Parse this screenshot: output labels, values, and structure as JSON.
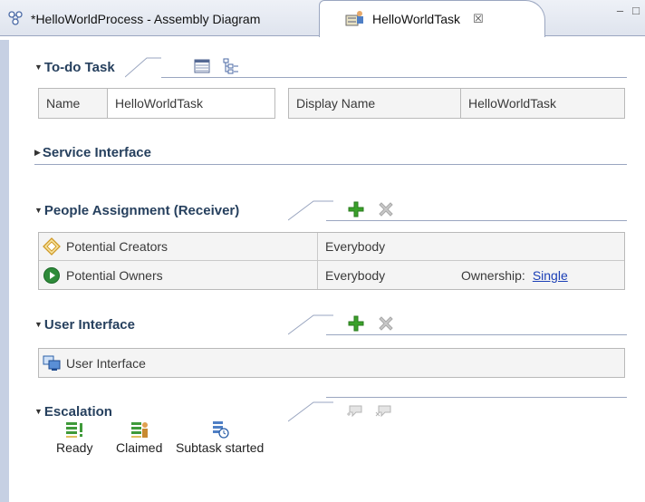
{
  "tabs": [
    {
      "label": "*HelloWorldProcess - Assembly Diagram",
      "icon": "assembly-diagram-icon",
      "active": false
    },
    {
      "label": "HelloWorldTask",
      "icon": "human-task-icon",
      "active": true,
      "close_glyph": "☒"
    }
  ],
  "window_controls": {
    "minimize": "–",
    "maximize": "□"
  },
  "todo_task": {
    "title": "To-do Task",
    "name_label": "Name",
    "name_value": "HelloWorldTask",
    "display_name_label": "Display Name",
    "display_name_value": "HelloWorldTask"
  },
  "service_interface": {
    "title": "Service Interface"
  },
  "people_assignment": {
    "title": "People Assignment (Receiver)",
    "rows": [
      {
        "role": "Potential Creators",
        "value": "Everybody",
        "ownership_label": "",
        "ownership_value": ""
      },
      {
        "role": "Potential Owners",
        "value": "Everybody",
        "ownership_label": "Ownership:",
        "ownership_value": "Single"
      }
    ]
  },
  "user_interface": {
    "title": "User Interface",
    "rows": [
      {
        "label": "User Interface"
      }
    ]
  },
  "escalation": {
    "title": "Escalation",
    "states": [
      {
        "label": "Ready",
        "icon": "ready-state-icon"
      },
      {
        "label": "Claimed",
        "icon": "claimed-state-icon"
      },
      {
        "label": "Subtask started",
        "icon": "subtask-started-icon"
      }
    ]
  },
  "colors": {
    "accent": "#26405e",
    "link": "#1b3fb6",
    "add_green": "#3aa12a",
    "remove_gray": "#b9b9b9"
  }
}
